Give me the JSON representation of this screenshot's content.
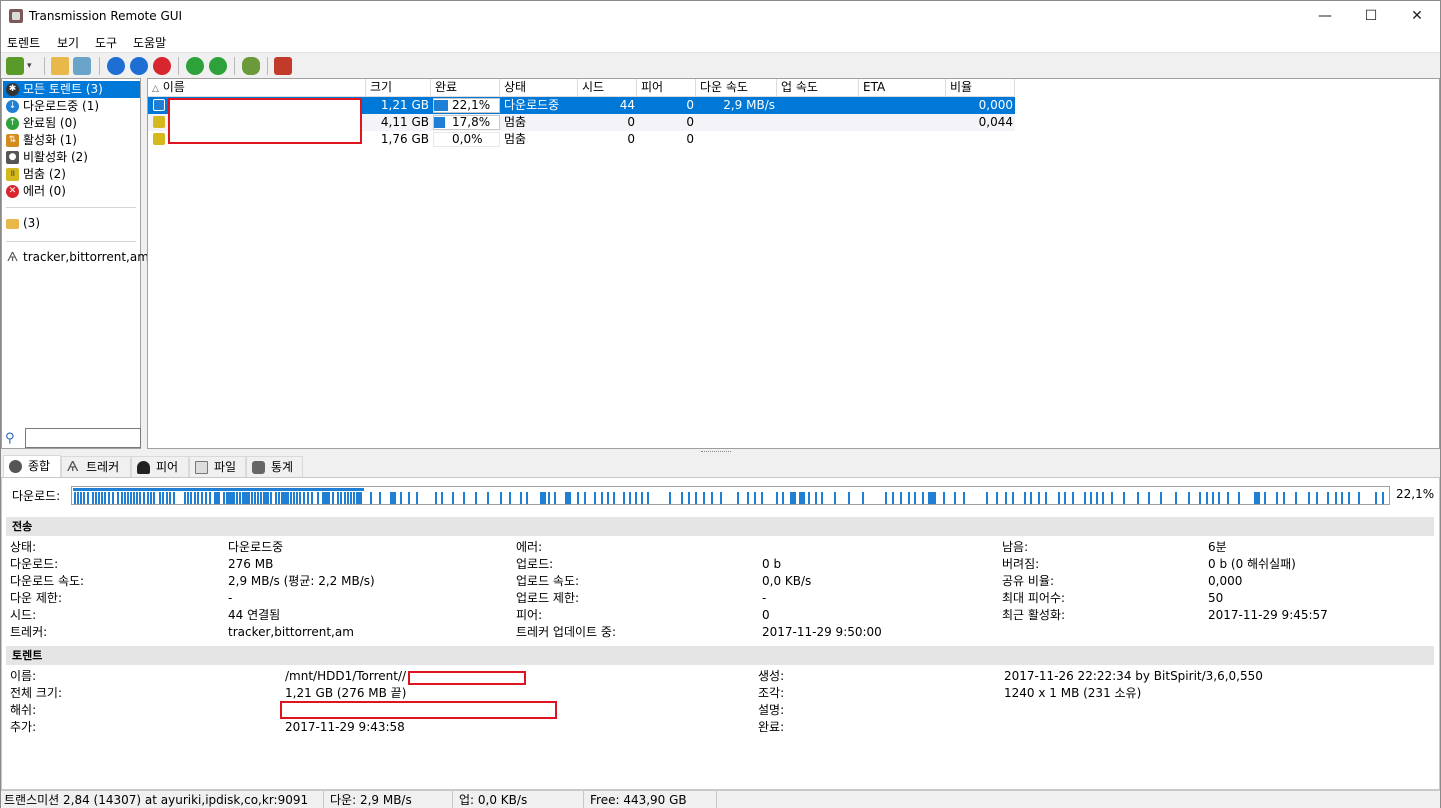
{
  "window": {
    "title": "Transmission Remote GUI",
    "min": "—",
    "max": "☐",
    "close": "✕"
  },
  "menu": [
    "토렌트",
    "보기",
    "도구",
    "도움말"
  ],
  "sidebar": {
    "states": [
      {
        "label": "모든 토렌트 (3)",
        "icon": "all-icon",
        "color": "#333333"
      },
      {
        "label": "다운로드중 (1)",
        "icon": "download-icon",
        "color": "#1e7fd4"
      },
      {
        "label": "완료됨 (0)",
        "icon": "complete-icon",
        "color": "#2ea23a"
      },
      {
        "label": "활성화 (1)",
        "icon": "active-icon",
        "color": "#d48b1e"
      },
      {
        "label": "비활성화 (2)",
        "icon": "inactive-icon",
        "color": "#555555"
      },
      {
        "label": "멈춤 (2)",
        "icon": "paused-icon",
        "color": "#d4b81e"
      },
      {
        "label": "에러 (0)",
        "icon": "error-icon",
        "color": "#d8262e"
      }
    ],
    "folder": "(3)",
    "tracker": "tracker,bittorrent,am",
    "search_value": ""
  },
  "grid": {
    "headers": [
      "이름",
      "크기",
      "완료",
      "상태",
      "시드",
      "피어",
      "다운 속도",
      "업 속도",
      "ETA",
      "비율"
    ],
    "rows": [
      {
        "size": "1,21 GB",
        "done": "22,1%",
        "done_frac": 0.221,
        "status": "다운로드중",
        "seeds": "44",
        "peers": "0",
        "down": "2,9 MB/s",
        "up": "",
        "eta": "",
        "ratio": "0,000",
        "state": "downloading"
      },
      {
        "size": "4,11 GB",
        "done": "17,8%",
        "done_frac": 0.178,
        "status": "멈춤",
        "seeds": "0",
        "peers": "0",
        "down": "",
        "up": "",
        "eta": "",
        "ratio": "0,044",
        "state": "paused"
      },
      {
        "size": "1,76 GB",
        "done": "0,0%",
        "done_frac": 0.0,
        "status": "멈춤",
        "seeds": "0",
        "peers": "0",
        "down": "",
        "up": "",
        "eta": "",
        "ratio": "",
        "state": "paused"
      }
    ]
  },
  "tabs": [
    "종합",
    "트레커",
    "피어",
    "파일",
    "통계"
  ],
  "general": {
    "download_label": "다운로드:",
    "download_pct": "22,1%",
    "download_frac": 0.221,
    "transfer_title": "전송",
    "torrent_title": "토렌트",
    "transfer": {
      "col1": [
        [
          "상태:",
          "다운로드중"
        ],
        [
          "다운로드:",
          "276 MB"
        ],
        [
          "다운로드 속도:",
          "2,9 MB/s (평균: 2,2 MB/s)"
        ],
        [
          "다운 제한:",
          "-"
        ],
        [
          "시드:",
          "44 연결됨"
        ],
        [
          "트레커:",
          "tracker,bittorrent,am"
        ]
      ],
      "col2": [
        [
          "에러:",
          ""
        ],
        [
          "업로드:",
          "0 b"
        ],
        [
          "업로드 속도:",
          "0,0 KB/s"
        ],
        [
          "업로드 제한:",
          "-"
        ],
        [
          "피어:",
          "0"
        ],
        [
          "트레커 업데이트 중:",
          "2017-11-29 9:50:00"
        ]
      ],
      "col3": [
        [
          "남음:",
          "6분"
        ],
        [
          "버려짐:",
          "0 b (0 해쉬실패)"
        ],
        [
          "공유 비율:",
          "0,000"
        ],
        [
          "최대 피어수:",
          "50"
        ],
        [
          "최근 활성화:",
          "2017-11-29 9:45:57"
        ]
      ]
    },
    "torrent": {
      "col1": [
        [
          "이름:",
          "/mnt/HDD1/Torrent//"
        ],
        [
          "전체 크기:",
          "1,21 GB (276 MB 끝)"
        ],
        [
          "해쉬:",
          ""
        ],
        [
          "추가:",
          "2017-11-29 9:43:58"
        ]
      ],
      "col2": [
        [
          "생성:",
          "2017-11-26 22:22:34 by BitSpirit/3,6,0,550"
        ],
        [
          "조각:",
          "1240 x 1 MB (231 소유)"
        ],
        [
          "설명:",
          ""
        ],
        [
          "완료:",
          ""
        ]
      ]
    }
  },
  "statusbar": {
    "server": "트랜스미션 2,84 (14307) at ayuriki,ipdisk,co,kr:9091",
    "down": "다운: 2,9 MB/s",
    "up": "업: 0,0 KB/s",
    "free": "Free: 443,90 GB"
  },
  "colors": {
    "accent": "#0078d7",
    "progress": "#1e7fd4",
    "redaction": "#e0141e"
  }
}
